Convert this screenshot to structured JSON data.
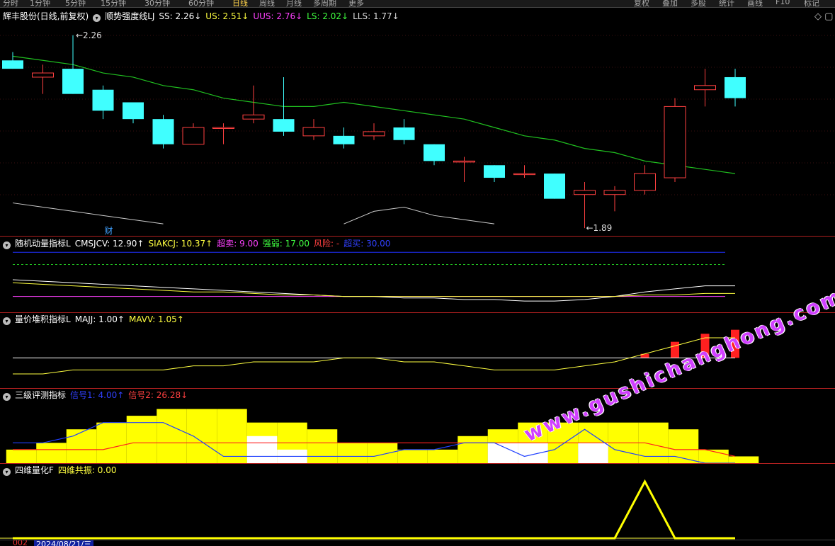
{
  "toolbar": {
    "left_items": [
      "分时",
      "1分钟",
      "5分钟",
      "15分钟",
      "30分钟",
      "60分钟",
      "日线",
      "周线",
      "月线",
      "多周期",
      "更多"
    ],
    "active": "日线",
    "right_items": [
      "复权",
      "叠加",
      "多股",
      "统计",
      "画线",
      "F10",
      "标记"
    ]
  },
  "main_header": {
    "title": "辉丰股份(日线,前复权)",
    "indicator": "顺势强度线LJ",
    "values": [
      {
        "label": "SS: 2.26↓",
        "color": "#ffffff"
      },
      {
        "label": "US: 2.51↓",
        "color": "#ffff40"
      },
      {
        "label": "UUS: 2.76↓",
        "color": "#ff40ff"
      },
      {
        "label": "LS: 2.02↓",
        "color": "#40ff40"
      },
      {
        "label": "LLS: 1.77↓",
        "color": "#dddddd"
      }
    ]
  },
  "panel2_header": {
    "title": "随机动量指标L",
    "values": [
      {
        "label": "CMSJCV: 12.90↑",
        "color": "#ffffff"
      },
      {
        "label": "SIAKCJ: 10.37↑",
        "color": "#ffff40"
      },
      {
        "label": "超卖: 9.00",
        "color": "#ff40ff"
      },
      {
        "label": "强弱: 17.00",
        "color": "#40ff40"
      },
      {
        "label": "风险: -",
        "color": "#ff4040"
      },
      {
        "label": "超买: 30.00",
        "color": "#3040ff"
      }
    ]
  },
  "panel3_header": {
    "title": "量价堆积指标L",
    "values": [
      {
        "label": "MAJJ: 1.00↑",
        "color": "#ffffff"
      },
      {
        "label": "MAVV: 1.05↑",
        "color": "#ffff40"
      }
    ]
  },
  "panel4_header": {
    "title": "三级评测指标",
    "values": [
      {
        "label": "信号1: 4.00↑",
        "color": "#3040ff"
      },
      {
        "label": "信号2: 26.28↓",
        "color": "#ff4040"
      }
    ]
  },
  "panel5_header": {
    "title": "四维量化F",
    "values": [
      {
        "label": "四维共振: 0.00",
        "color": "#ffff40"
      }
    ]
  },
  "status": {
    "code": "002",
    "date": "2024/08/21/三"
  },
  "watermark": "www.gushichanghong.com",
  "chart_data": {
    "type": "candlestick",
    "colors": {
      "up": "#ff4040",
      "down": "#40ffff",
      "ma": "#20c020",
      "yellow": "#ffff00"
    },
    "candles": [
      {
        "o": 2.2,
        "h": 2.22,
        "l": 2.18,
        "c": 2.18
      },
      {
        "o": 2.16,
        "h": 2.19,
        "l": 2.12,
        "c": 2.17
      },
      {
        "o": 2.18,
        "h": 2.26,
        "l": 2.12,
        "c": 2.12
      },
      {
        "o": 2.13,
        "h": 2.14,
        "l": 2.06,
        "c": 2.08
      },
      {
        "o": 2.1,
        "h": 2.1,
        "l": 2.05,
        "c": 2.06
      },
      {
        "o": 2.06,
        "h": 2.07,
        "l": 1.99,
        "c": 2.0
      },
      {
        "o": 2.0,
        "h": 2.05,
        "l": 2.0,
        "c": 2.04
      },
      {
        "o": 2.04,
        "h": 2.05,
        "l": 2.0,
        "c": 2.04
      },
      {
        "o": 2.06,
        "h": 2.14,
        "l": 2.05,
        "c": 2.07
      },
      {
        "o": 2.06,
        "h": 2.16,
        "l": 2.02,
        "c": 2.03
      },
      {
        "o": 2.02,
        "h": 2.06,
        "l": 2.01,
        "c": 2.04
      },
      {
        "o": 2.02,
        "h": 2.04,
        "l": 1.99,
        "c": 2.0
      },
      {
        "o": 2.02,
        "h": 2.05,
        "l": 2.01,
        "c": 2.03
      },
      {
        "o": 2.04,
        "h": 2.06,
        "l": 2.0,
        "c": 2.01
      },
      {
        "o": 2.0,
        "h": 2.0,
        "l": 1.95,
        "c": 1.96
      },
      {
        "o": 1.96,
        "h": 1.97,
        "l": 1.91,
        "c": 1.96
      },
      {
        "o": 1.95,
        "h": 1.95,
        "l": 1.91,
        "c": 1.92
      },
      {
        "o": 1.93,
        "h": 1.95,
        "l": 1.92,
        "c": 1.93
      },
      {
        "o": 1.93,
        "h": 1.93,
        "l": 1.87,
        "c": 1.87
      },
      {
        "o": 1.88,
        "h": 1.91,
        "l": 1.8,
        "c": 1.89
      },
      {
        "o": 1.88,
        "h": 1.9,
        "l": 1.84,
        "c": 1.89
      },
      {
        "o": 1.89,
        "h": 1.95,
        "l": 1.88,
        "c": 1.93
      },
      {
        "o": 1.92,
        "h": 2.11,
        "l": 1.91,
        "c": 2.09
      },
      {
        "o": 2.13,
        "h": 2.18,
        "l": 2.09,
        "c": 2.14
      },
      {
        "o": 2.16,
        "h": 2.18,
        "l": 2.09,
        "c": 2.11
      }
    ],
    "ma": [
      2.21,
      2.2,
      2.19,
      2.17,
      2.16,
      2.14,
      2.13,
      2.11,
      2.1,
      2.09,
      2.09,
      2.1,
      2.09,
      2.08,
      2.07,
      2.06,
      2.04,
      2.02,
      2.01,
      1.99,
      1.98,
      1.96,
      1.95,
      1.94,
      1.93
    ],
    "price_range": [
      1.79,
      2.29
    ],
    "high_label": "2.26",
    "low_label": "1.89",
    "marker": "财",
    "osc_main": [
      1.86,
      1.85,
      1.84,
      1.83,
      1.82,
      1.81,
      null,
      null,
      null,
      null,
      null,
      1.81,
      1.84,
      1.85,
      1.83,
      1.82,
      1.81,
      null,
      null,
      null,
      null,
      null,
      null,
      null,
      null
    ],
    "p2": {
      "line1": [
        20,
        19,
        18,
        17,
        16,
        15,
        14,
        13,
        12,
        11,
        10,
        9,
        9,
        8,
        8,
        7,
        7,
        6,
        6,
        7,
        9,
        12,
        14,
        16,
        16
      ],
      "line2": [
        18,
        17,
        16,
        15,
        14,
        13,
        12,
        12,
        11,
        10,
        10,
        9,
        9,
        9,
        9,
        9,
        9,
        9,
        9,
        9,
        9,
        10,
        10,
        11,
        11
      ],
      "overbought": 30,
      "oversold": 9,
      "range": [
        0,
        40
      ]
    },
    "p3": {
      "majj": [
        1,
        1,
        1,
        1,
        1,
        1,
        1,
        1,
        1,
        1,
        1,
        1,
        1,
        1,
        1,
        1,
        1,
        1,
        1,
        1,
        1,
        1,
        1,
        1,
        1
      ],
      "mavv": [
        0.96,
        0.96,
        0.97,
        0.97,
        0.97,
        0.97,
        0.98,
        0.98,
        0.99,
        0.99,
        0.99,
        1.0,
        1.0,
        0.99,
        0.99,
        0.98,
        0.97,
        0.97,
        0.97,
        0.98,
        0.99,
        1.01,
        1.03,
        1.05,
        1.05
      ],
      "bars": [
        0,
        0,
        0,
        0,
        0,
        0,
        0,
        0,
        0,
        0,
        0,
        0,
        0,
        0,
        0,
        0,
        0,
        0,
        0,
        0,
        0,
        1.01,
        1.04,
        1.06,
        1.07
      ],
      "range": [
        0.93,
        1.08
      ]
    },
    "p4": {
      "yellow": [
        2,
        3,
        5,
        6,
        7,
        8,
        8,
        8,
        6,
        6,
        5,
        3,
        3,
        2,
        2,
        4,
        5,
        6,
        6,
        6,
        6,
        6,
        5,
        2,
        1
      ],
      "white": [
        0,
        0,
        0,
        0,
        0,
        0,
        0,
        0,
        4,
        2,
        0,
        0,
        0,
        0,
        0,
        0,
        3,
        3,
        0,
        3,
        0,
        0,
        0,
        0,
        0
      ],
      "blue": [
        3,
        3,
        4,
        6,
        6,
        6,
        4,
        1,
        1,
        1,
        1,
        1,
        1,
        2,
        2,
        3,
        3,
        1,
        2,
        5,
        2,
        1,
        1,
        0,
        0
      ],
      "red": [
        2,
        2,
        2,
        2,
        3,
        3,
        3,
        3,
        3,
        3,
        3,
        3,
        3,
        3,
        3,
        3,
        3,
        3,
        3,
        3,
        3,
        3,
        2,
        2,
        1
      ],
      "range": [
        0,
        9
      ]
    },
    "p5": {
      "line": [
        0,
        0,
        0,
        0,
        0,
        0,
        0,
        0,
        0,
        0,
        0,
        0,
        0,
        0,
        0,
        0,
        0,
        0,
        0,
        0,
        0,
        1,
        0,
        0,
        0
      ],
      "range": [
        0,
        1.1
      ]
    }
  }
}
